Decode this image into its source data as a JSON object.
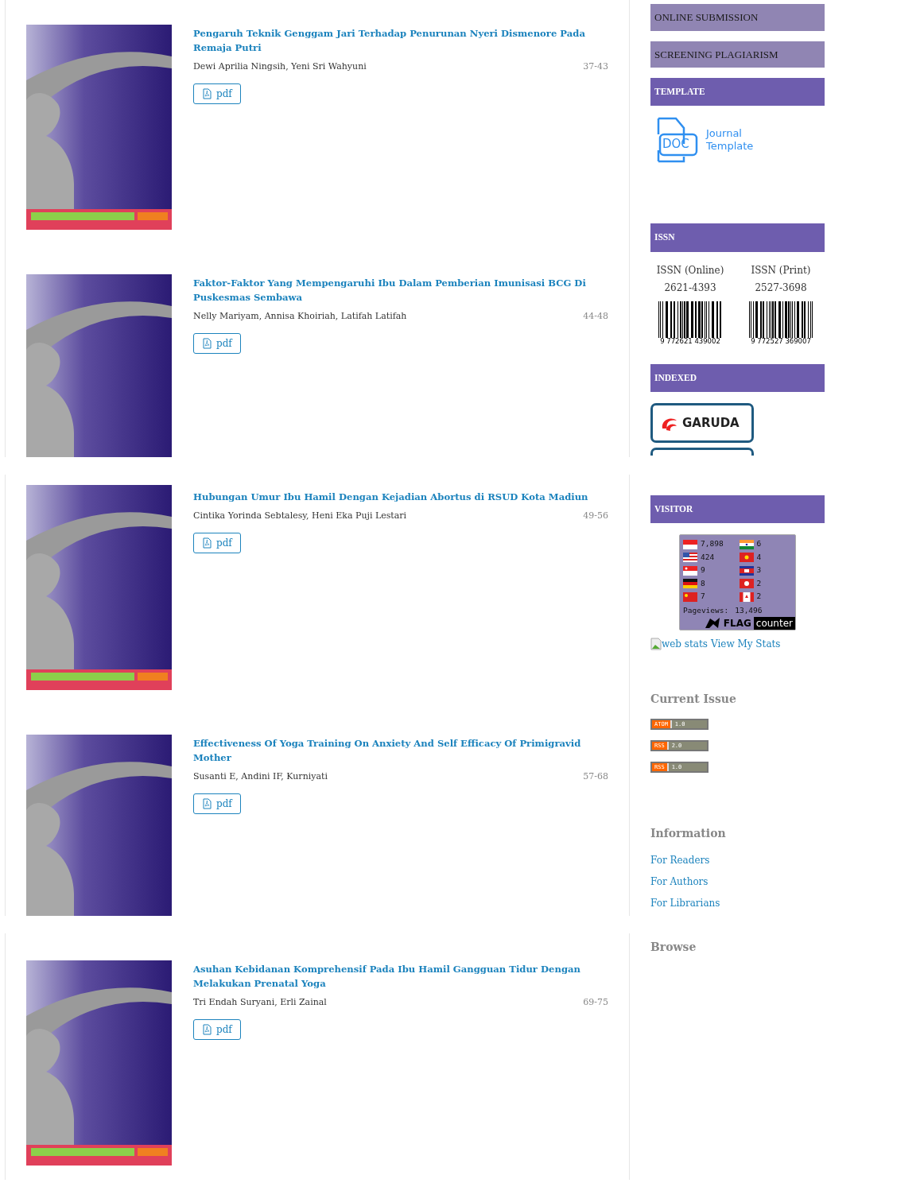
{
  "panels": [
    {
      "articles": [
        {
          "title": "Pengaruh Teknik Genggam Jari Terhadap Penurunan Nyeri Dismenore Pada Remaja Putri",
          "authors": "Dewi Aprilia Ningsih, Yeni Sri Wahyuni",
          "pages": "37-43",
          "file": "pdf"
        },
        {
          "title": "Faktor-Faktor Yang Mempengaruhi Ibu Dalam Pemberian Imunisasi BCG Di Puskesmas Sembawa",
          "authors": "Nelly Mariyam, Annisa Khoiriah, Latifah Latifah",
          "pages": "44-48",
          "file": "pdf"
        }
      ],
      "sidebar": [
        {
          "kind": "menu",
          "label": "ONLINE SUBMISSION"
        },
        {
          "kind": "menu",
          "label": "SCREENING PLAGIARISM"
        },
        {
          "kind": "header",
          "label": "TEMPLATE"
        },
        {
          "kind": "template",
          "icon_text": "DOC",
          "lines": [
            "Journal",
            "Template"
          ]
        },
        {
          "kind": "header",
          "label": "ISSN"
        },
        {
          "kind": "issn",
          "items": [
            {
              "label": "ISSN (Online)",
              "number": "2621-4393",
              "barcode": "9 772621 439002"
            },
            {
              "label": "ISSN (Print)",
              "number": "2527-3698",
              "barcode": "9 772527 369007"
            }
          ]
        },
        {
          "kind": "header",
          "label": "INDEXED"
        },
        {
          "kind": "logos",
          "items": [
            "GARUDA"
          ],
          "cut_off": true
        }
      ]
    },
    {
      "articles": [
        {
          "title": "Hubungan Umur Ibu Hamil Dengan Kejadian Abortus di RSUD Kota Madiun",
          "authors": "Cintika Yorinda Sebtalesy, Heni Eka Puji Lestari",
          "pages": "49-56",
          "file": "pdf"
        },
        {
          "title": "Effectiveness Of Yoga Training On Anxiety And Self Efficacy Of Primigravid Mother",
          "authors": "Susanti E, Andini IF, Kurniyati",
          "pages": "57-68",
          "file": "pdf"
        }
      ],
      "sidebar": [
        {
          "kind": "header",
          "label": "VISITOR"
        },
        {
          "kind": "counter",
          "counts": [
            [
              "7,898",
              "6"
            ],
            [
              "424",
              "4"
            ],
            [
              "9",
              "3"
            ],
            [
              "8",
              "2"
            ],
            [
              "7",
              "2"
            ]
          ],
          "pageviews_label": "Pageviews:",
          "pageviews": "13,496",
          "brand": [
            "FLAG",
            "counter"
          ]
        },
        {
          "kind": "stats",
          "alt": "web stats",
          "link": "View My Stats"
        },
        {
          "kind": "heading",
          "label": "Current Issue"
        },
        {
          "kind": "feeds",
          "items": [
            [
              "ATOM",
              "1.0"
            ],
            [
              "RSS",
              "2.0"
            ],
            [
              "RSS",
              "1.0"
            ]
          ]
        },
        {
          "kind": "heading",
          "label": "Information"
        },
        {
          "kind": "links",
          "items": [
            "For Readers",
            "For Authors",
            "For Librarians"
          ]
        }
      ]
    },
    {
      "articles": [
        {
          "title": "Asuhan Kebidanan Komprehensif Pada Ibu Hamil Gangguan Tidur Dengan Melakukan Prenatal Yoga",
          "authors": "Tri Endah Suryani, Erli Zainal",
          "pages": "69-75",
          "file": "pdf"
        }
      ],
      "sidebar": [
        {
          "kind": "heading",
          "label": "Browse"
        }
      ]
    }
  ]
}
